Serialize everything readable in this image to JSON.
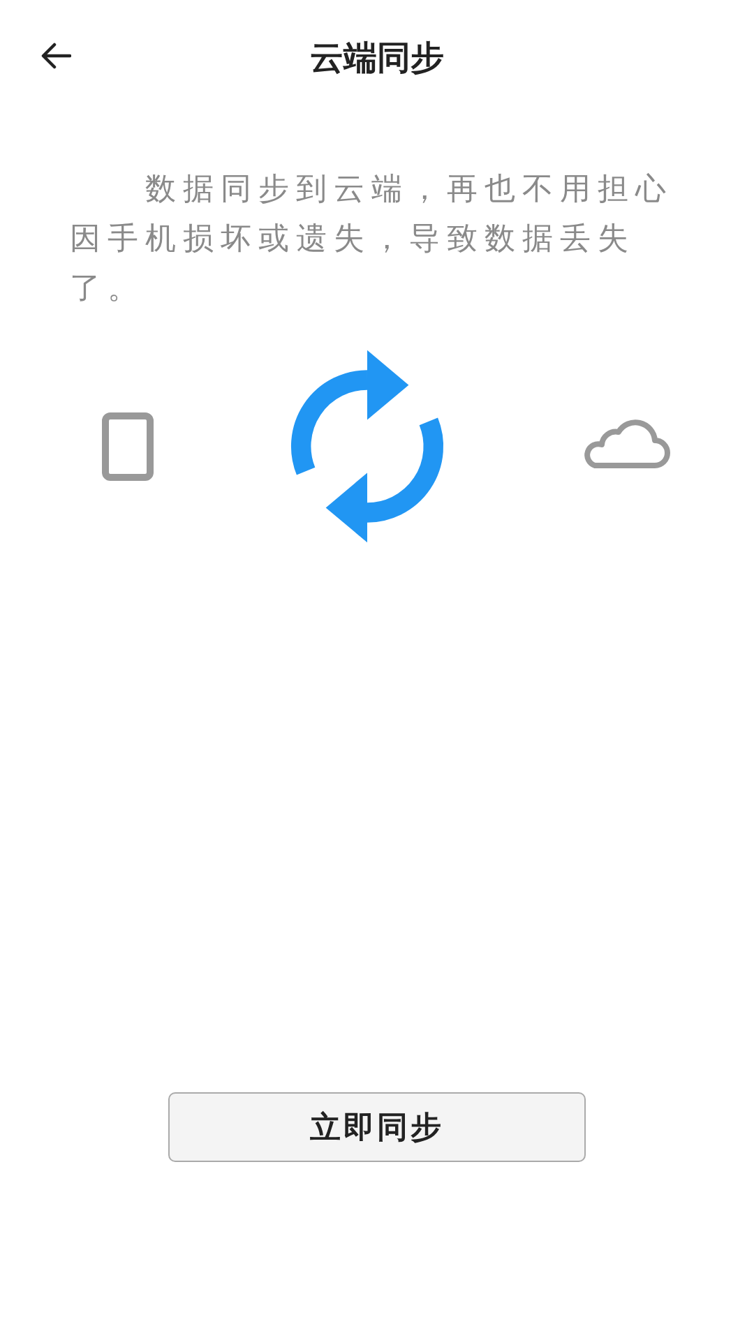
{
  "header": {
    "title": "云端同步"
  },
  "description": "数据同步到云端，再也不用担心因手机损坏或遗失，导致数据丢失了。",
  "sync_button": {
    "label": "立即同步"
  }
}
